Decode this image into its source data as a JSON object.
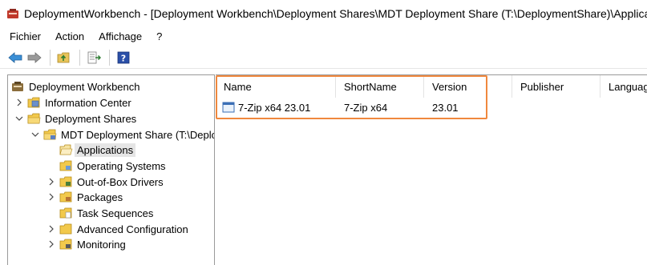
{
  "window": {
    "title": "DeploymentWorkbench - [Deployment Workbench\\Deployment Shares\\MDT Deployment Share (T:\\DeploymentShare)\\Applications]"
  },
  "menu": {
    "items": [
      "Fichier",
      "Action",
      "Affichage",
      "?"
    ]
  },
  "toolbar": {
    "buttons": [
      "back-arrow-icon",
      "forward-arrow-icon",
      "up-folder-icon",
      "export-list-icon",
      "help-icon"
    ]
  },
  "tree": {
    "root": "Deployment Workbench",
    "items": [
      {
        "label": "Information Center"
      },
      {
        "label": "Deployment Shares"
      },
      {
        "label": "MDT Deployment Share (T:\\Deplo"
      },
      {
        "label": "Applications"
      },
      {
        "label": "Operating Systems"
      },
      {
        "label": "Out-of-Box Drivers"
      },
      {
        "label": "Packages"
      },
      {
        "label": "Task Sequences"
      },
      {
        "label": "Advanced Configuration"
      },
      {
        "label": "Monitoring"
      }
    ]
  },
  "list": {
    "columns": [
      "Name",
      "ShortName",
      "Version",
      "Publisher",
      "Languag"
    ],
    "rows": [
      {
        "name": "7-Zip x64 23.01",
        "shortname": "7-Zip x64",
        "version": "23.01"
      }
    ]
  },
  "colors": {
    "highlight": "#f0883e",
    "selected_bg": "#e5e5e5"
  }
}
